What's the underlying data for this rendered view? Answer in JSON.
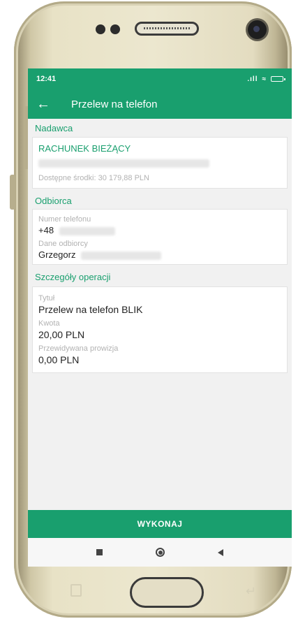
{
  "status_bar": {
    "time": "12:41",
    "signal": ".ıll",
    "wifi": "≈"
  },
  "app_bar": {
    "title": "Przelew na telefon"
  },
  "sender": {
    "section_title": "Nadawca",
    "account_name": "RACHUNEK BIEŻĄCY",
    "available_funds": "Dostępne środki: 30 179,88 PLN"
  },
  "recipient": {
    "section_title": "Odbiorca",
    "phone_label": "Numer telefonu",
    "phone_value": "+48",
    "name_label": "Dane odbiorcy",
    "name_value": "Grzegorz"
  },
  "details": {
    "section_title": "Szczegóły operacji",
    "title_label": "Tytuł",
    "title_value": "Przelew na telefon BLIK",
    "amount_label": "Kwota",
    "amount_value": "20,00 PLN",
    "fee_label": "Przewidywana prowizja",
    "fee_value": "0,00 PLN"
  },
  "actions": {
    "execute_label": "WYKONAJ"
  },
  "colors": {
    "brand": "#199f6e",
    "background": "#f1f1f1"
  },
  "icons": [
    "back-arrow-icon",
    "signal-icon",
    "wifi-icon",
    "battery-icon",
    "recent-apps-icon",
    "home-icon",
    "nav-back-icon"
  ]
}
